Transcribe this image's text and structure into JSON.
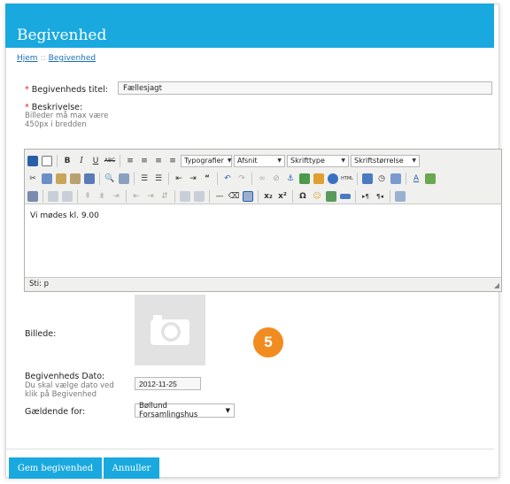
{
  "header": {
    "title": "Begivenhed"
  },
  "breadcrumb": {
    "home": "Hjem",
    "separator": "::",
    "current": "Begivenhed"
  },
  "form": {
    "required_marker": "*",
    "title_label": "Begivenheds titel:",
    "title_value": "Fællesjagt",
    "description_label": "Beskrivelse:",
    "description_hint": "Billeder må max være 450px i bredden",
    "image_label": "Billede:",
    "date_label": "Begivenheds Dato:",
    "date_hint": "Du skal vælge dato ved klik på Begivenhed",
    "date_value": "2012-11-25",
    "applies_label": "Gældende for:",
    "applies_value": "Bøllund Forsamlingshus"
  },
  "editor": {
    "format_select": "Typografier",
    "paragraph_select": "Afsnit",
    "font_select": "Skrifttype",
    "size_select": "Skriftstørrelse",
    "content": "Vi mødes kl. 9.00",
    "status_path": "Sti: p"
  },
  "badge": {
    "number": "5",
    "color": "#f28c20"
  },
  "buttons": {
    "save": "Gem begivenhed",
    "cancel": "Annuller"
  },
  "colors": {
    "accent": "#1aa9df",
    "required": "#dd2222",
    "link": "#1a6fb5"
  }
}
